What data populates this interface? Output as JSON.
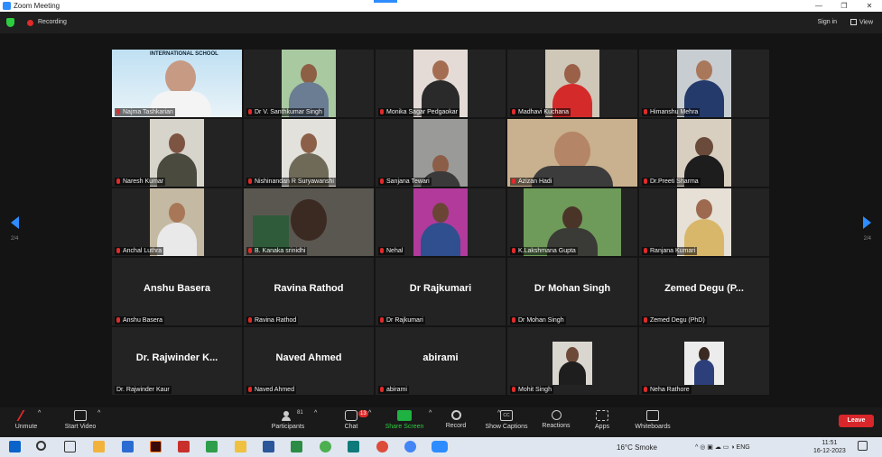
{
  "window": {
    "title": "Zoom Meeting"
  },
  "topbar": {
    "recording": "Recording",
    "signin": "Sign in",
    "view": "View"
  },
  "pagination": {
    "left": "2/4",
    "right": "2/4"
  },
  "participants": [
    {
      "name": "Najma Tashkarian",
      "video": true,
      "overlay": "INTERNATIONAL SCHOOL"
    },
    {
      "name": "Dr V. Santhkumar Singh",
      "video": true
    },
    {
      "name": "Monika Sagar Pedgaokar",
      "video": true
    },
    {
      "name": "Madhavi Kuchana",
      "video": true
    },
    {
      "name": "Himanshu Mehra",
      "video": true
    },
    {
      "name": "Naresh Kumar",
      "video": true
    },
    {
      "name": "Nishinandan R Suryawanshi",
      "video": true
    },
    {
      "name": "Sanjana Tewari",
      "video": true
    },
    {
      "name": "Azizan Hadi",
      "video": true
    },
    {
      "name": "Dr.Preeti Sharma",
      "video": true
    },
    {
      "name": "Anchal Luthra",
      "video": true
    },
    {
      "name": "B. Kanaka srinidhi",
      "video": true
    },
    {
      "name": "Nehal",
      "video": true
    },
    {
      "name": "K.Lakshmana Gupta",
      "video": true
    },
    {
      "name": "Ranjana Kumari",
      "video": true
    },
    {
      "name": "Anshu Basera",
      "video": false,
      "display": "Anshu Basera"
    },
    {
      "name": "Ravina Rathod",
      "video": false,
      "display": "Ravina Rathod"
    },
    {
      "name": "Dr Rajkumari",
      "video": false,
      "display": "Dr Rajkumari"
    },
    {
      "name": "Dr Mohan Singh",
      "video": false,
      "display": "Dr Mohan Singh"
    },
    {
      "name": "Zemed Degu (PhD)",
      "video": false,
      "display": "Zemed Degu (P..."
    },
    {
      "name": "Dr. Rajwinder Kaur",
      "video": false,
      "display": "Dr. Rajwinder K..."
    },
    {
      "name": "Naved Ahmed",
      "video": false,
      "display": "Naved Ahmed"
    },
    {
      "name": "abirami",
      "video": false,
      "display": "abirami"
    },
    {
      "name": "Mohit Singh",
      "video": true
    },
    {
      "name": "Neha Rathore",
      "video": true
    }
  ],
  "toolbar": {
    "unmute": "Unmute",
    "start_video": "Start Video",
    "participants": "Participants",
    "participants_count": "81",
    "chat": "Chat",
    "chat_badge": "13",
    "share": "Share Screen",
    "record": "Record",
    "captions": "Show Captions",
    "reactions": "Reactions",
    "apps": "Apps",
    "whiteboards": "Whiteboards",
    "leave": "Leave"
  },
  "taskbar": {
    "weather": "16°C  Smoke",
    "lang": "ENG",
    "time": "11:51",
    "date": "16-12-2023"
  },
  "colors": {
    "accent": "#2d8cff",
    "share": "#1fb141",
    "leave": "#d8262b",
    "recording": "#e02b2b"
  }
}
